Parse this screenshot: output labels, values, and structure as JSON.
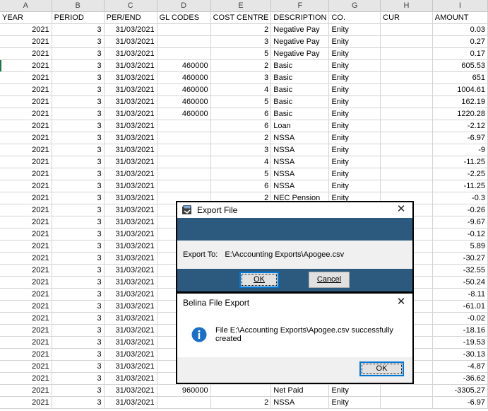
{
  "sheet": {
    "column_letters": [
      "A",
      "B",
      "C",
      "D",
      "E",
      "F",
      "G",
      "H",
      "I"
    ],
    "headers": [
      "YEAR",
      "PERIOD",
      "PER/END",
      "GL CODES",
      "COST CENTRE",
      "DESCRIPTION",
      "CO.",
      "CUR",
      "AMOUNT"
    ],
    "rows": [
      [
        "2021",
        "3",
        "31/03/2021",
        "",
        "2",
        "Negative Pay",
        "Enity",
        "",
        "0.03"
      ],
      [
        "2021",
        "3",
        "31/03/2021",
        "",
        "3",
        "Negative Pay",
        "Enity",
        "",
        "0.27"
      ],
      [
        "2021",
        "3",
        "31/03/2021",
        "",
        "5",
        "Negative Pay",
        "Enity",
        "",
        "0.17"
      ],
      [
        "2021",
        "3",
        "31/03/2021",
        "460000",
        "2",
        "Basic",
        "Enity",
        "",
        "605.53"
      ],
      [
        "2021",
        "3",
        "31/03/2021",
        "460000",
        "3",
        "Basic",
        "Enity",
        "",
        "651"
      ],
      [
        "2021",
        "3",
        "31/03/2021",
        "460000",
        "4",
        "Basic",
        "Enity",
        "",
        "1004.61"
      ],
      [
        "2021",
        "3",
        "31/03/2021",
        "460000",
        "5",
        "Basic",
        "Enity",
        "",
        "162.19"
      ],
      [
        "2021",
        "3",
        "31/03/2021",
        "460000",
        "6",
        "Basic",
        "Enity",
        "",
        "1220.28"
      ],
      [
        "2021",
        "3",
        "31/03/2021",
        "",
        "6",
        "Loan",
        "Enity",
        "",
        "-2.12"
      ],
      [
        "2021",
        "3",
        "31/03/2021",
        "",
        "2",
        "NSSA",
        "Enity",
        "",
        "-6.97"
      ],
      [
        "2021",
        "3",
        "31/03/2021",
        "",
        "3",
        "NSSA",
        "Enity",
        "",
        "-9"
      ],
      [
        "2021",
        "3",
        "31/03/2021",
        "",
        "4",
        "NSSA",
        "Enity",
        "",
        "-11.25"
      ],
      [
        "2021",
        "3",
        "31/03/2021",
        "",
        "5",
        "NSSA",
        "Enity",
        "",
        "-2.25"
      ],
      [
        "2021",
        "3",
        "31/03/2021",
        "",
        "6",
        "NSSA",
        "Enity",
        "",
        "-11.25"
      ],
      [
        "2021",
        "3",
        "31/03/2021",
        "",
        "2",
        "NEC Pension",
        "Enity",
        "",
        "-0.3"
      ],
      [
        "2021",
        "3",
        "31/03/2021",
        "",
        "",
        "",
        "",
        "",
        "-0.26"
      ],
      [
        "2021",
        "3",
        "31/03/2021",
        "",
        "",
        "",
        "",
        "",
        "-9.67"
      ],
      [
        "2021",
        "3",
        "31/03/2021",
        "",
        "",
        "",
        "",
        "",
        "-0.12"
      ],
      [
        "2021",
        "3",
        "31/03/2021",
        "",
        "",
        "",
        "",
        "",
        "5.89"
      ],
      [
        "2021",
        "3",
        "31/03/2021",
        "",
        "",
        "",
        "",
        "",
        "-30.27"
      ],
      [
        "2021",
        "3",
        "31/03/2021",
        "",
        "",
        "",
        "",
        "",
        "-32.55"
      ],
      [
        "2021",
        "3",
        "31/03/2021",
        "",
        "",
        "",
        "",
        "",
        "-50.24"
      ],
      [
        "2021",
        "3",
        "31/03/2021",
        "",
        "",
        "",
        "",
        "",
        "-8.11"
      ],
      [
        "2021",
        "3",
        "31/03/2021",
        "",
        "",
        "",
        "",
        "",
        "-61.01"
      ],
      [
        "2021",
        "3",
        "31/03/2021",
        "",
        "",
        "",
        "",
        "",
        "-0.02"
      ],
      [
        "2021",
        "3",
        "31/03/2021",
        "",
        "",
        "",
        "",
        "",
        "-18.16"
      ],
      [
        "2021",
        "3",
        "31/03/2021",
        "",
        "",
        "",
        "",
        "",
        "-19.53"
      ],
      [
        "2021",
        "3",
        "31/03/2021",
        "",
        "",
        "",
        "",
        "",
        "-30.13"
      ],
      [
        "2021",
        "3",
        "31/03/2021",
        "",
        "",
        "",
        "",
        "",
        "-4.87"
      ],
      [
        "2021",
        "3",
        "31/03/2021",
        "",
        "",
        "",
        "",
        "",
        "-36.62"
      ],
      [
        "2021",
        "3",
        "31/03/2021",
        "960000",
        "",
        "Net Paid",
        "Enity",
        "",
        "-3305.27"
      ],
      [
        "2021",
        "3",
        "31/03/2021",
        "",
        "2",
        "NSSA",
        "Enity",
        "",
        "-6.97"
      ]
    ]
  },
  "export_dialog": {
    "title": "Export File",
    "export_to_label": "Export To:",
    "export_to_path": "E:\\Accounting Exports\\Apogee.csv",
    "ok_label": "OK",
    "cancel_label": "Cancel",
    "close_glyph": "✕",
    "band_color": "#2b5a7e"
  },
  "message_dialog": {
    "title": "Belina File Export",
    "message": "File E:\\Accounting Exports\\Apogee.csv successfully created",
    "ok_label": "OK",
    "close_glyph": "✕",
    "icon": "info-icon",
    "icon_color": "#1a6fc9"
  }
}
